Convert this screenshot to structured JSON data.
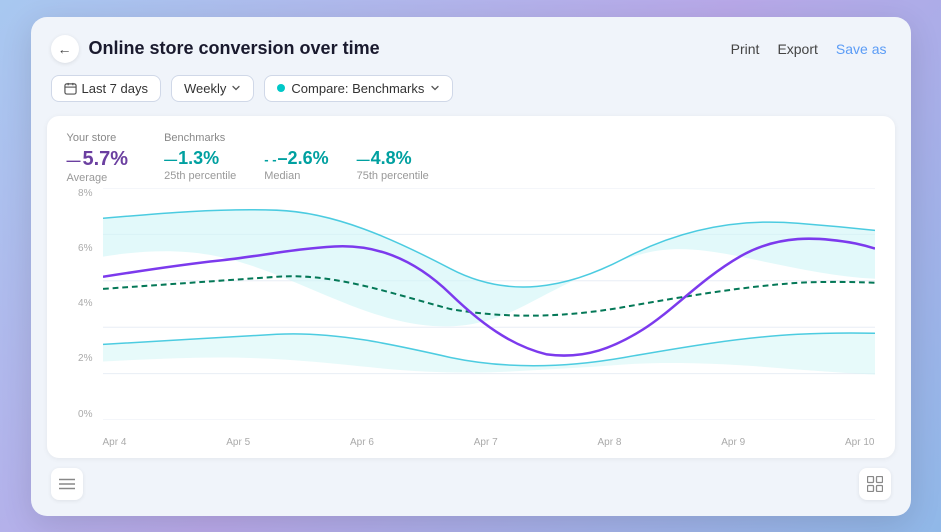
{
  "header": {
    "title": "Online store conversion over time",
    "back_label": "←",
    "actions": {
      "print": "Print",
      "export": "Export",
      "save": "Save as"
    }
  },
  "toolbar": {
    "date_range": "Last 7 days",
    "frequency": "Weekly",
    "compare": "Compare: Benchmarks"
  },
  "stats": {
    "your_store_label": "Your store",
    "benchmarks_label": "Benchmarks",
    "your_store_value": "5.7%",
    "your_store_sub": "Average",
    "bench1_value": "1.3%",
    "bench1_sub": "25th percentile",
    "bench2_value": "–2.6%",
    "bench2_sub": "Median",
    "bench3_value": "4.8%",
    "bench3_sub": "75th percentile"
  },
  "chart": {
    "y_labels": [
      "8%",
      "6%",
      "4%",
      "2%",
      "0%"
    ],
    "x_labels": [
      "Apr 4",
      "Apr 5",
      "Apr 6",
      "Apr 7",
      "Apr 8",
      "Apr 9",
      "Apr 10"
    ],
    "colors": {
      "purple": "#7c3aed",
      "teal": "#06b6d4",
      "teal_light": "#a5f3fc",
      "dashed": "#047857"
    }
  },
  "bottom": {
    "left_icon": "≡",
    "right_icon": "⊞"
  }
}
